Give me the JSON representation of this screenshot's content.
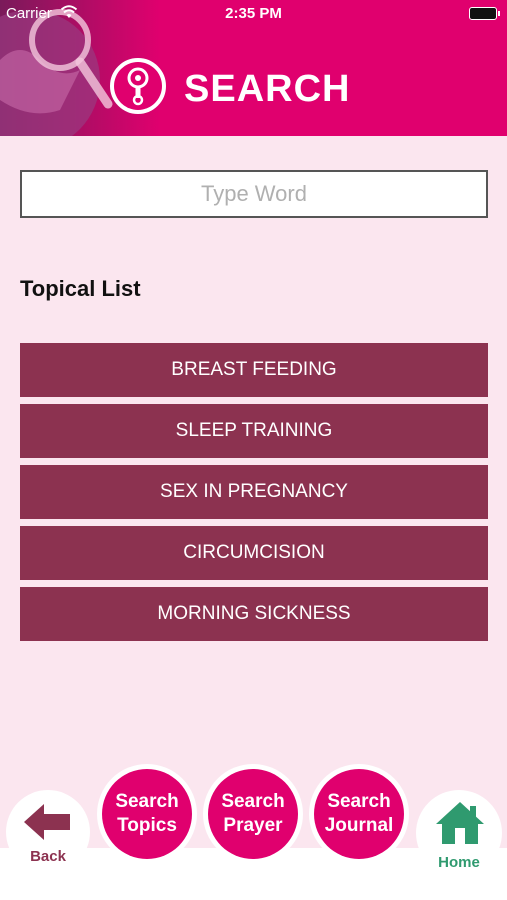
{
  "status_bar": {
    "carrier": "Carrier",
    "time": "2:35 PM"
  },
  "header": {
    "title": "SEARCH",
    "logo_icon": "rattle-icon"
  },
  "search": {
    "placeholder": "Type Word",
    "value": ""
  },
  "topical_list": {
    "title": "Topical List",
    "items": [
      {
        "label": "BREAST FEEDING"
      },
      {
        "label": "SLEEP TRAINING"
      },
      {
        "label": "SEX IN PREGNANCY"
      },
      {
        "label": "CIRCUMCISION"
      },
      {
        "label": "MORNING SICKNESS"
      }
    ]
  },
  "bottom_nav": {
    "back_label": "Back",
    "search_topics_label": "Search\nTopics",
    "search_prayer_label": "Search\nPrayer",
    "search_journal_label": "Search\nJournal",
    "home_label": "Home"
  },
  "colors": {
    "header_pink": "#e0006e",
    "background": "#fbe6ef",
    "topic_button": "#8c3250",
    "home_green": "#2f9a6f"
  }
}
